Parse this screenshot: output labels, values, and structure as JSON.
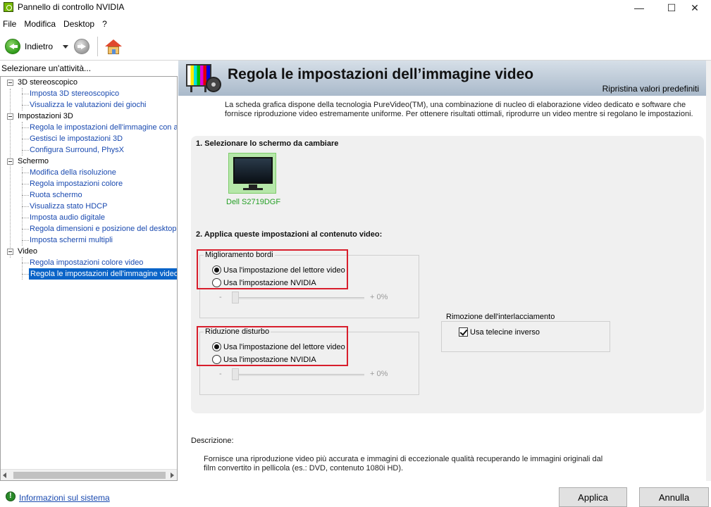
{
  "window": {
    "title": "Pannello di controllo NVIDIA",
    "min_glyph": "—",
    "max_glyph": "☐",
    "close_glyph": "✕"
  },
  "menu": [
    "File",
    "Modifica",
    "Desktop",
    "?"
  ],
  "toolbar": {
    "back_label": "Indietro",
    "icons": [
      "back-arrow-icon",
      "dropdown-arrow-icon",
      "forward-arrow-icon",
      "home-icon"
    ]
  },
  "left_panel": {
    "header": "Selezionare un'attività...",
    "tree": [
      {
        "label": "3D stereoscopico",
        "children": [
          "Imposta 3D stereoscopico",
          "Visualizza le valutazioni dei giochi"
        ]
      },
      {
        "label": "Impostazioni 3D",
        "children": [
          "Regola le impostazioni dell'immagine con an",
          "Gestisci le impostazioni 3D",
          "Configura Surround, PhysX"
        ]
      },
      {
        "label": "Schermo",
        "children": [
          "Modifica della risoluzione",
          "Regola impostazioni colore",
          "Ruota schermo",
          "Visualizza stato HDCP",
          "Imposta audio digitale",
          "Regola dimensioni e posizione del desktop",
          "Imposta schermi multipli"
        ]
      },
      {
        "label": "Video",
        "children": [
          "Regola impostazioni colore video",
          "Regola le impostazioni dell'immagine video"
        ]
      }
    ],
    "selected": "Regola le impostazioni dell'immagine video"
  },
  "content": {
    "title": "Regola le impostazioni dell’immagine video",
    "restore_defaults": "Ripristina valori predefiniti",
    "intro": "La scheda grafica dispone della tecnologia PureVideo(TM), una combinazione di nucleo di elaborazione video dedicato e software che fornisce riproduzione video estremamente uniforme. Per ottenere risultati ottimali, riprodurre un video mentre si regolano le impostazioni.",
    "section1_title": "1. Selezionare lo schermo da cambiare",
    "monitor_label": "Dell S2719DGF",
    "section2_title": "2. Applica queste impostazioni al contenuto video:",
    "edge_enhancement": {
      "label": "Miglioramento bordi",
      "option_player": "Usa l'impostazione del lettore video",
      "option_nvidia": "Usa l'impostazione NVIDIA",
      "selected": "player",
      "slider_minus": "-",
      "slider_value": "+ 0%",
      "slider_level_percent": 0
    },
    "noise_reduction": {
      "label": "Riduzione disturbo",
      "option_player": "Usa l'impostazione del lettore video",
      "option_nvidia": "Usa l'impostazione NVIDIA",
      "selected": "player",
      "slider_minus": "-",
      "slider_value": "+ 0%",
      "slider_level_percent": 0
    },
    "deinterlacing": {
      "label": "Rimozione dell'interlacciamento",
      "checkbox_label": "Usa telecine inverso",
      "checked": true
    },
    "description_label": "Descrizione:",
    "description_text": "Fornisce una riproduzione video più accurata e immagini di eccezionale qualità recuperando le immagini originali dal film convertito in pellicola (es.: DVD, contenuto 1080i HD)."
  },
  "footer": {
    "system_info_link": "Informazioni sul sistema",
    "apply_button": "Applica",
    "cancel_button": "Annulla"
  },
  "colors": {
    "accent_red_outline": "#d81e2c",
    "selection_blue": "#0a64c8",
    "link_blue": "#1a4ab0",
    "monitor_green": "#26a026"
  }
}
